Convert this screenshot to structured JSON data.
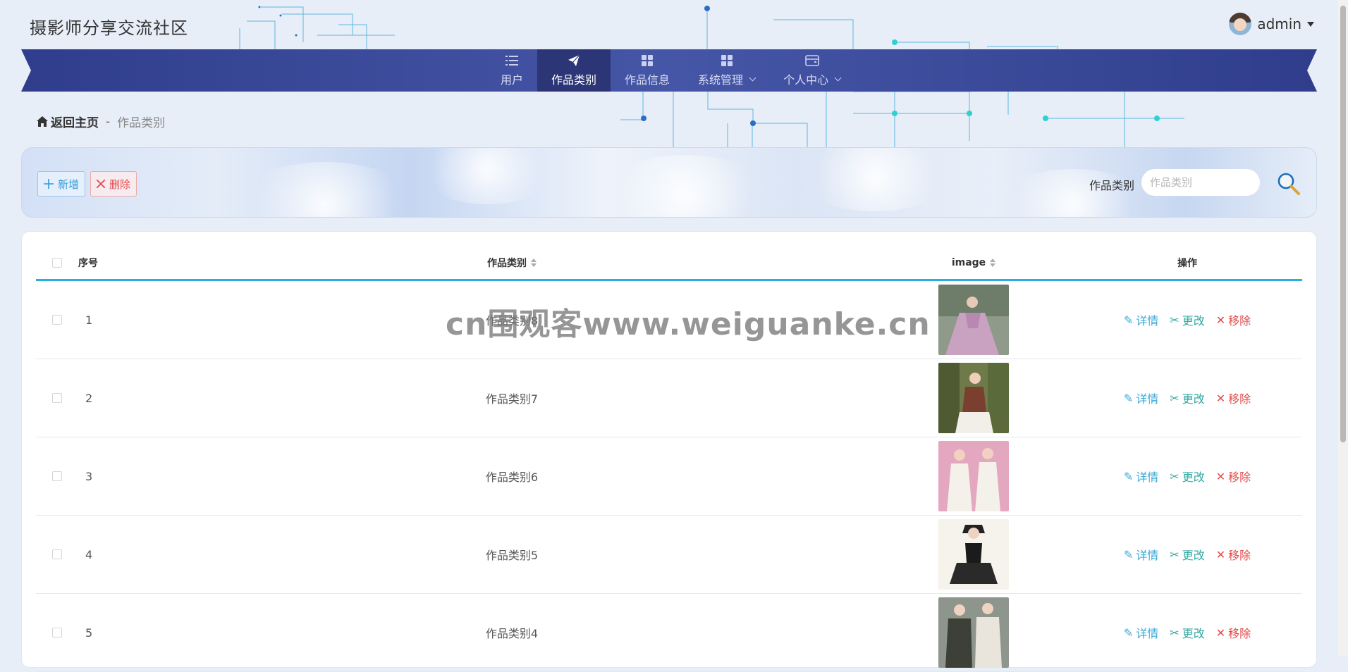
{
  "header": {
    "site_title": "摄影师分享交流社区",
    "username": "admin"
  },
  "nav": {
    "items": [
      {
        "label": "用户",
        "icon": "list-icon",
        "active": false,
        "has_dropdown": false
      },
      {
        "label": "作品类别",
        "icon": "paper-plane-icon",
        "active": true,
        "has_dropdown": false
      },
      {
        "label": "作品信息",
        "icon": "grid-icon",
        "active": false,
        "has_dropdown": false
      },
      {
        "label": "系统管理",
        "icon": "grid-icon",
        "active": false,
        "has_dropdown": true
      },
      {
        "label": "个人中心",
        "icon": "wallet-icon",
        "active": false,
        "has_dropdown": true
      }
    ]
  },
  "breadcrumb": {
    "home": "返回主页",
    "separator": "-",
    "current": "作品类别"
  },
  "toolbar": {
    "add_label": "新增",
    "delete_label": "删除",
    "search_label": "作品类别",
    "search_placeholder": "作品类别"
  },
  "table": {
    "headers": {
      "index": "序号",
      "category": "作品类别",
      "image": "image",
      "ops": "操作"
    },
    "ops_labels": {
      "detail": "详情",
      "edit": "更改",
      "remove": "移除"
    },
    "rows": [
      {
        "index": "1",
        "category": "作品类别8"
      },
      {
        "index": "2",
        "category": "作品类别7"
      },
      {
        "index": "3",
        "category": "作品类别6"
      },
      {
        "index": "4",
        "category": "作品类别5"
      },
      {
        "index": "5",
        "category": "作品类别4"
      }
    ]
  },
  "watermark": "cn围观客www.weiguanke.cn",
  "colors": {
    "nav_bg": "#3a4a9a",
    "nav_active": "#2c3676",
    "accent_blue": "#29aee0",
    "danger": "#e24b4b",
    "edit": "#33a7a2"
  }
}
